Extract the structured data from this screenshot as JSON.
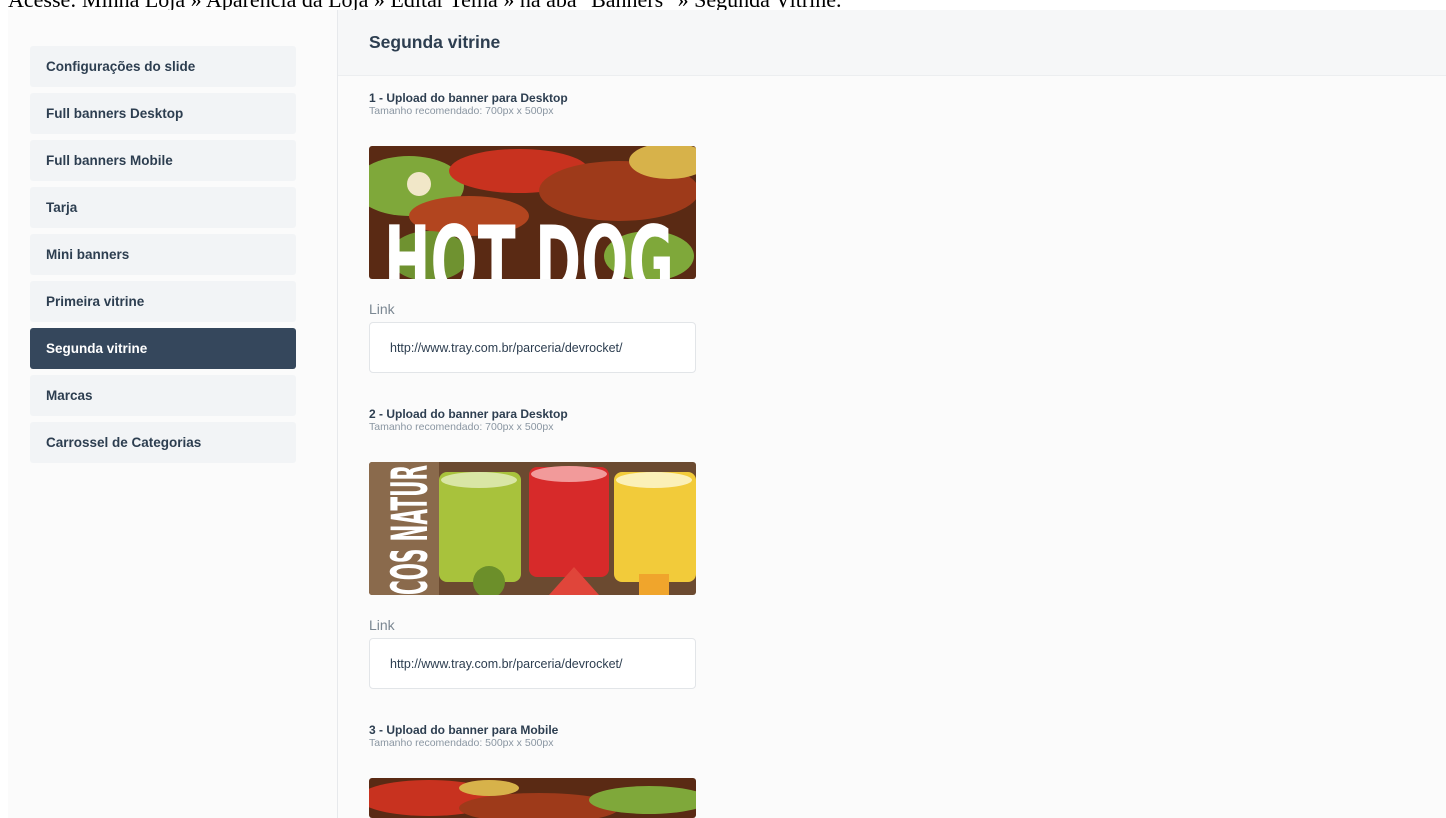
{
  "instruction": "Acesse: Minha Loja » Aparência da Loja » Editar Tema » na aba \"Banners\" » Segunda Vitrine.",
  "sidebar": {
    "items": [
      {
        "label": "Configurações do slide"
      },
      {
        "label": "Full banners Desktop"
      },
      {
        "label": "Full banners Mobile"
      },
      {
        "label": "Tarja"
      },
      {
        "label": "Mini banners"
      },
      {
        "label": "Primeira vitrine"
      },
      {
        "label": "Segunda vitrine",
        "active": true
      },
      {
        "label": "Marcas"
      },
      {
        "label": "Carrossel de Categorias"
      }
    ]
  },
  "main": {
    "title": "Segunda vitrine",
    "uploads": [
      {
        "title": "1 - Upload do banner para Desktop",
        "hint": "Tamanho recomendado: 700px x 500px",
        "banner_text": "HOT DOG",
        "link_label": "Link",
        "link_value": "http://www.tray.com.br/parceria/devrocket/"
      },
      {
        "title": "2 - Upload do banner para Desktop",
        "hint": "Tamanho recomendado: 700px x 500px",
        "banner_text": "COS NATUR",
        "link_label": "Link",
        "link_value": "http://www.tray.com.br/parceria/devrocket/"
      },
      {
        "title": "3 - Upload do banner para Mobile",
        "hint": "Tamanho recomendado: 500px x 500px"
      }
    ]
  },
  "colors": {
    "sidebar_active_bg": "#35475c",
    "sidebar_item_bg": "#f2f4f6",
    "text_primary": "#2d3e50",
    "text_muted": "#8a96a2"
  }
}
